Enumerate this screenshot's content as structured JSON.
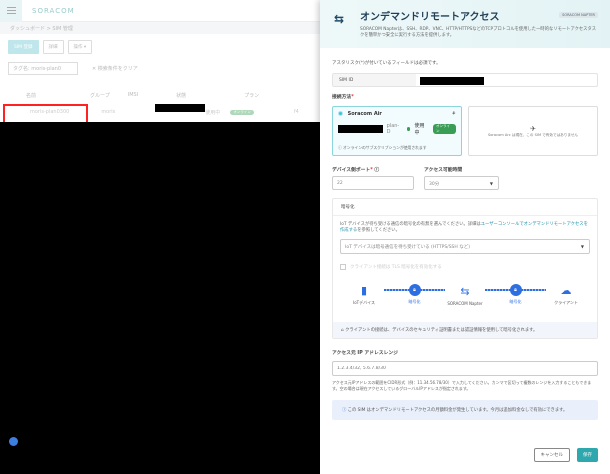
{
  "bg": {
    "logo": "SORACOM",
    "breadcrumb": "ダッシュボード > SIM 管理",
    "buttons": [
      "SIM 登録",
      "詳細",
      "操作 ▾"
    ],
    "search_tag": "タグ名: moris-plan0",
    "clear": "✕ 検索条件をクリア",
    "columns": [
      "名前",
      "グループ",
      "IMSI",
      "状態",
      "プラン"
    ],
    "row": {
      "name": "moris-plan0300",
      "group": "moris",
      "status": "使用中",
      "badge": "オンライン",
      "plan": "f4"
    }
  },
  "panel": {
    "title": "オンデマンドリモートアクセス",
    "tag": "SORACOM NAPTER",
    "description": "SORACOM Napterは、SSH、RDP、VNC、HTTP/HTTPSなどのTCPプロトコルを使用した一時的なリモートアクセスタスクを簡単かつ安全に実行する方法を提供します。",
    "required_note_pre": "アスタリスク(",
    "required_note_post": ")が付いているフィールドは必須です。",
    "sim_id_label": "SIM ID",
    "connection_label": "接続方法",
    "card_air": {
      "title": "Soracom Air",
      "plan": "plan-D",
      "status": "使用中",
      "badge": "オンライン",
      "note": "オンラインのサブスクリプションが使用されます"
    },
    "card_other": {
      "note": "Soracom Arc は現在、この SIM で有効ではありません"
    },
    "port_label": "デバイス側ポート",
    "port_value": "22",
    "duration_label": "アクセス可能時間",
    "duration_value": "30分",
    "enc": {
      "title": "暗号化",
      "desc_pre": "IoT デバイスが待ち受ける通信の暗号化の有無を選んでください。詳細は",
      "desc_link": "ユーザーコンソールでオンデマンドリモートアクセスを作成する",
      "desc_post": "を参照してください。",
      "select": "IoT デバイスは暗号通信を待ち受けている (HTTPS/SSH など)",
      "checkbox": "クライアント接続は TLS 暗号化を有効化する",
      "nodes": [
        "IoTデバイス",
        "SORACOM Napter",
        "クライアント"
      ],
      "link_label": "暗号化",
      "info": "クライアントの接続は、デバイスのセキュリティ証明書または認証情報を使用して暗号化されます。"
    },
    "ip_label": "アクセス元 IP アドレスレンジ",
    "ip_placeholder": "1.2.3.4/32, 5.6.7.8/30",
    "ip_help": "アクセス元IPアドレスの範囲をCIDR形式（例：11.34.56.78/30）で入力してください。カンマで区切って複数のレンジを入力することもできます。空の場合は現在アクセスしているグローバルIPアドレスが指定されます。",
    "fee_note": "この SIM はオンデマンドリモートアクセスの月額料金が発生しています。今月は追加料金なしで有効にできます。",
    "cancel": "キャンセル",
    "save": "保存"
  },
  "colors": {
    "accent": "#2ea8ad",
    "flow": "#2d6fe0",
    "online": "#3a9d55"
  }
}
